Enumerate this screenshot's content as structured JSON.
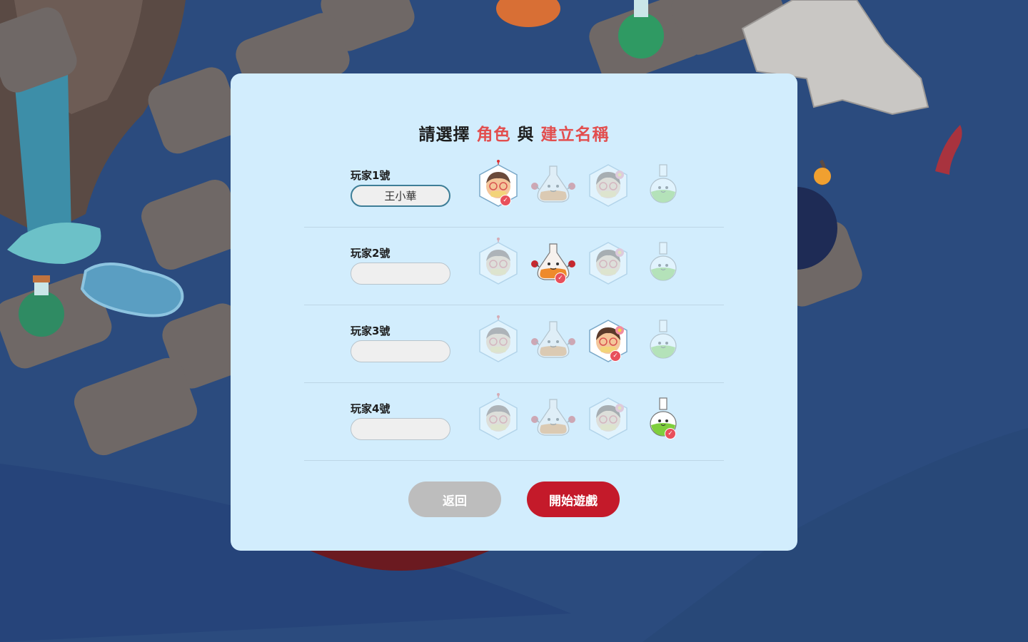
{
  "dialog": {
    "title_parts": [
      "請選擇 ",
      "角色",
      " 與 ",
      "建立名稱"
    ],
    "back_label": "返回",
    "start_label": "開始遊戲"
  },
  "characters": [
    "glasses-boy-icon",
    "flask-mascot-icon",
    "flower-girl-icon",
    "green-flask-icon"
  ],
  "players": [
    {
      "label": "玩家1號",
      "name": "王小華",
      "selected_character": 0
    },
    {
      "label": "玩家2號",
      "name": "",
      "selected_character": 1
    },
    {
      "label": "玩家3號",
      "name": "",
      "selected_character": 2
    },
    {
      "label": "玩家4號",
      "name": "",
      "selected_character": 3
    }
  ],
  "colors": {
    "modal_bg": "#d2edfd",
    "highlight": "#e24e4e",
    "start_button": "#c41a2a",
    "back_button": "#bdbdbd",
    "check": "#e8505b"
  }
}
